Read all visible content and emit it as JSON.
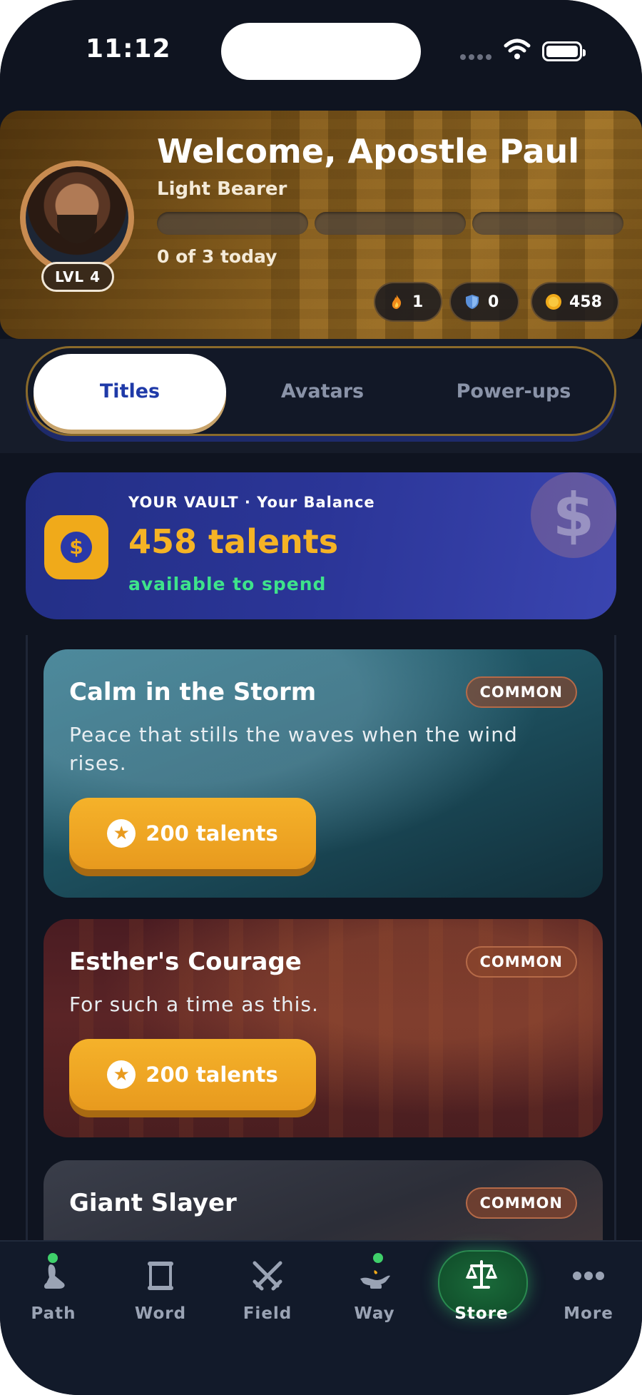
{
  "status_bar": {
    "time": "11:12"
  },
  "header": {
    "welcome": "Welcome, Apostle Paul",
    "title": "Light Bearer",
    "level_badge": "LVL 4",
    "progress_text": "0 of 3 today",
    "progress_completed": 0,
    "progress_total": 3,
    "stats": {
      "streak": "1",
      "shields": "0",
      "coins": "458"
    }
  },
  "tabs": [
    {
      "label": "Titles",
      "active": true
    },
    {
      "label": "Avatars",
      "active": false
    },
    {
      "label": "Power-ups",
      "active": false
    }
  ],
  "vault": {
    "label": "YOUR VAULT · Your Balance",
    "amount": "458 talents",
    "subtext": "available to spend"
  },
  "items": [
    {
      "name": "Calm in the Storm",
      "rarity": "COMMON",
      "description": "Peace that stills the waves when the wind rises.",
      "price": "200 talents"
    },
    {
      "name": "Esther's Courage",
      "rarity": "COMMON",
      "description": "For such a time as this.",
      "price": "200 talents"
    },
    {
      "name": "Giant Slayer",
      "rarity": "COMMON"
    }
  ],
  "nav": [
    {
      "label": "Path",
      "icon": "foot-icon"
    },
    {
      "label": "Word",
      "icon": "scroll-icon"
    },
    {
      "label": "Field",
      "icon": "swords-icon"
    },
    {
      "label": "Way",
      "icon": "lamp-icon"
    },
    {
      "label": "Store",
      "icon": "scales-icon",
      "active": true
    },
    {
      "label": "More",
      "icon": "more-icon"
    }
  ],
  "colors": {
    "accent_gold": "#f0aa1a",
    "tab_active_text": "#1f3aa8",
    "balance_green": "#3ee38a",
    "vault_bg": "#2b3597"
  }
}
